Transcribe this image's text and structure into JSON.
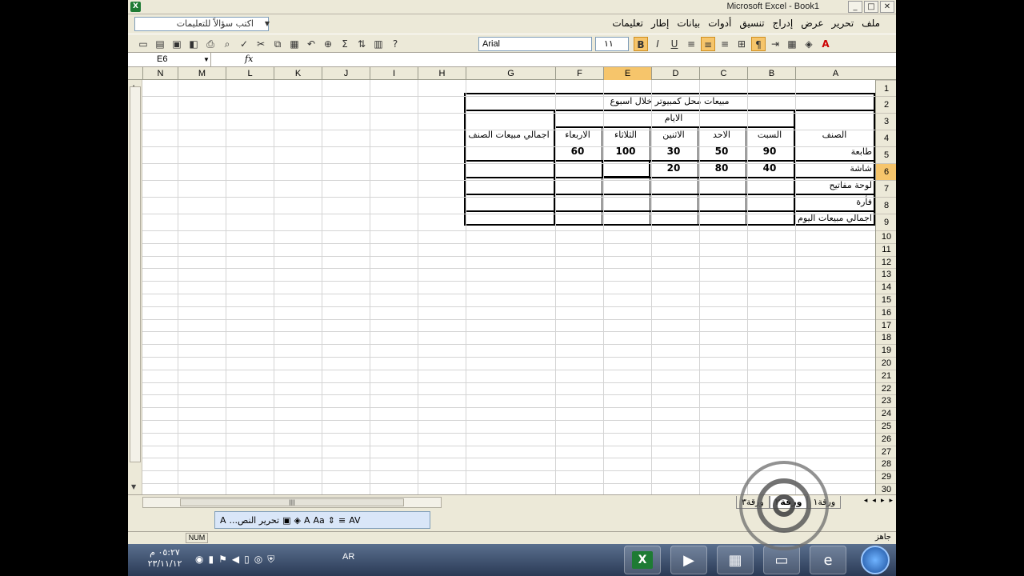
{
  "window": {
    "title": "Microsoft Excel - Book1",
    "controls": [
      "_",
      "□",
      "✕"
    ]
  },
  "menu": {
    "items": [
      "ملف",
      "تحرير",
      "عرض",
      "إدراج",
      "تنسيق",
      "أدوات",
      "بيانات",
      "إطار",
      "تعليمات"
    ],
    "ask_placeholder": "اكتب سؤالاً للتعليمات",
    "close": "✕"
  },
  "toolbar": {
    "font": "Arial",
    "size": "١١",
    "bold": "B",
    "italic": "I",
    "underline": "U",
    "font_color_letter": "A"
  },
  "formula_bar": {
    "name_box": "E6",
    "fx": "fx",
    "content": ""
  },
  "columns": [
    "N",
    "M",
    "L",
    "K",
    "J",
    "I",
    "H",
    "G",
    "F",
    "E",
    "D",
    "C",
    "B",
    "A"
  ],
  "selected_column": "E",
  "rows": [
    "1",
    "2",
    "3",
    "4",
    "5",
    "6",
    "7",
    "8",
    "9",
    "10",
    "11",
    "12",
    "13",
    "14",
    "15",
    "16",
    "17",
    "18",
    "19",
    "20",
    "21",
    "22",
    "23",
    "24",
    "25",
    "26",
    "27",
    "28",
    "29",
    "30"
  ],
  "selected_row": "6",
  "table": {
    "title": "مبيعات محل كمبيوتر خلال اسبوع",
    "days_header": "الايام",
    "category_header": "الصنف",
    "total_header": "اجمالي مبيعات الصنف",
    "days": [
      "السبت",
      "الاحد",
      "الاثنين",
      "الثلاثاء",
      "الاربعاء"
    ],
    "items": [
      {
        "name": "طابعة",
        "values": [
          "90",
          "50",
          "30",
          "100",
          "60"
        ]
      },
      {
        "name": "شاشة",
        "values": [
          "40",
          "80",
          "20",
          "",
          ""
        ]
      },
      {
        "name": "لوحة مفاتيح",
        "values": [
          "",
          "",
          "",
          "",
          ""
        ]
      },
      {
        "name": "فأرة",
        "values": [
          "",
          "",
          "",
          "",
          ""
        ]
      }
    ],
    "daily_total_label": "اجمالي مبيعات اليوم"
  },
  "sheet_tabs": [
    "ورقة١",
    "ورقة٢",
    "ورقة٣"
  ],
  "active_sheet": "ورقة٢",
  "draw_toolbar": {
    "edit_label": "تحرير النص..."
  },
  "status": {
    "ready": "جاهز",
    "num": "NUM"
  },
  "taskbar": {
    "time": "٠٥:٢٧ م",
    "date": "٢٣/١١/١٢",
    "lang": "AR"
  }
}
